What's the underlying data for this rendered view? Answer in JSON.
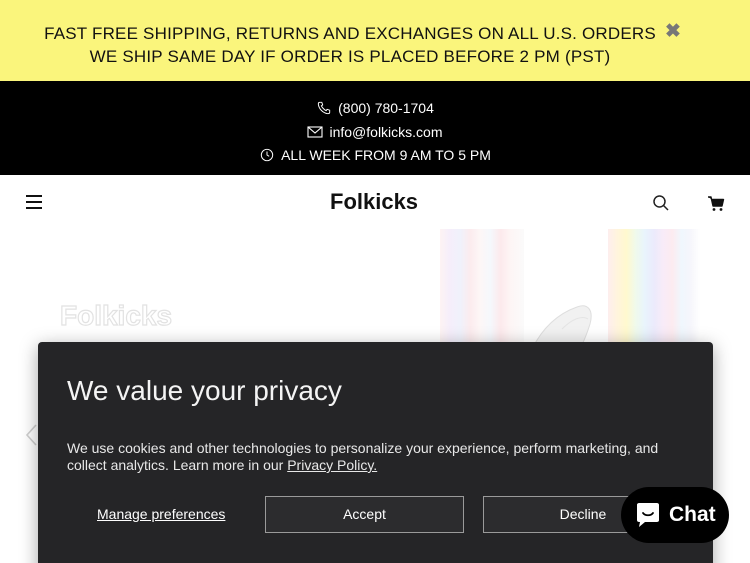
{
  "announcement": {
    "line1": "FAST FREE SHIPPING, RETURNS AND EXCHANGES ON ALL U.S. ORDERS",
    "line2": "WE SHIP SAME DAY IF ORDER IS PLACED BEFORE 2 PM (PST)",
    "close_icon": "close-icon",
    "close_glyph": "✖"
  },
  "contact": {
    "phone": "(800) 780-1704",
    "email": "info@folkicks.com",
    "hours": "ALL WEEK FROM 9 AM TO 5 PM"
  },
  "header": {
    "logo_text": "Folkicks",
    "icons": [
      "menu-icon",
      "search-icon",
      "cart-icon"
    ]
  },
  "hero": {
    "watermark_logo": "Folkicks"
  },
  "privacy": {
    "title": "We value your privacy",
    "description": "We use cookies and other technologies to personalize your experience, perform marketing, and collect analytics. Learn more in our",
    "policy_link": "Privacy Policy.",
    "manage_label": "Manage preferences",
    "accept_label": "Accept",
    "decline_label": "Decline"
  },
  "chat": {
    "label": "Chat"
  },
  "colors": {
    "announcement_bg": "#faf57c",
    "contact_bg": "#000000",
    "modal_bg": "#252527"
  }
}
